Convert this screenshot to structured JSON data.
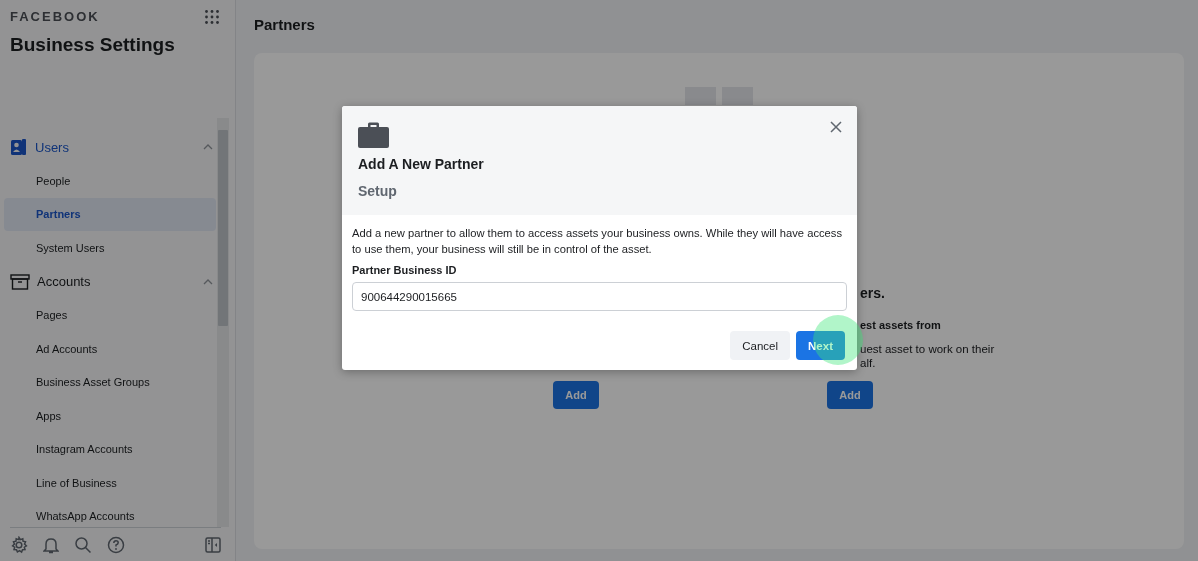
{
  "brand": "FACEBOOK",
  "app_title": "Business Settings",
  "sidebar": {
    "sections": [
      {
        "label": "Users",
        "kind": "users",
        "expanded": true,
        "items": [
          {
            "label": "People",
            "selected": false
          },
          {
            "label": "Partners",
            "selected": true
          },
          {
            "label": "System Users",
            "selected": false
          }
        ]
      },
      {
        "label": "Accounts",
        "kind": "accounts",
        "expanded": true,
        "items": [
          {
            "label": "Pages",
            "selected": false
          },
          {
            "label": "Ad Accounts",
            "selected": false
          },
          {
            "label": "Business Asset Groups",
            "selected": false
          },
          {
            "label": "Apps",
            "selected": false
          },
          {
            "label": "Instagram Accounts",
            "selected": false
          },
          {
            "label": "Line of Business",
            "selected": false
          },
          {
            "label": "WhatsApp Accounts",
            "selected": false
          }
        ]
      }
    ]
  },
  "page_title": "Partners",
  "background": {
    "left_button": "Add",
    "right_heading": "ers.",
    "right_subheading": "est assets from",
    "right_lines": [
      "uest asset to work on their",
      "alf."
    ],
    "right_button": "Add"
  },
  "dialog": {
    "title": "Add A New Partner",
    "subtitle": "Setup",
    "description": "Add a new partner to allow them to access assets your business owns. While they will have access to use them, your business will still be in control of the asset.",
    "field_label": "Partner Business ID",
    "field_value": "900644290015665",
    "buttons": [
      {
        "label": "Cancel",
        "kind": "secondary"
      },
      {
        "label": "Next",
        "kind": "primary"
      }
    ]
  }
}
